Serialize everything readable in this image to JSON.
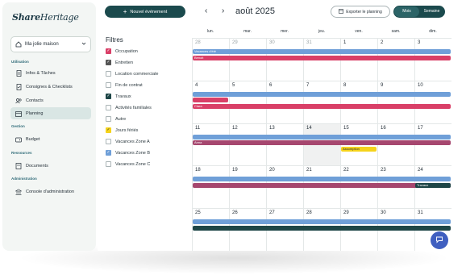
{
  "sidebar": {
    "logo_main": "Share",
    "logo_sub": "Heritage",
    "house": "Ma jolie maison",
    "sections": [
      {
        "label": "Utilisation",
        "items": [
          "Infos & Tâches",
          "Consignes & Checklists",
          "Contacts",
          "Planning"
        ]
      },
      {
        "label": "Gestion",
        "items": [
          "Budget"
        ]
      },
      {
        "label": "Ressources",
        "items": [
          "Documents"
        ]
      },
      {
        "label": "Administration",
        "items": [
          "Console d'administration"
        ]
      }
    ]
  },
  "filters": {
    "new_event": "Nouvel événement",
    "title": "Filtres",
    "items": [
      {
        "label": "Occupation",
        "checked": true,
        "color": "#d93f67"
      },
      {
        "label": "Entretien",
        "checked": true,
        "color": "#555555"
      },
      {
        "label": "Location commerciale",
        "checked": false,
        "color": ""
      },
      {
        "label": "Fin de contrat",
        "checked": false,
        "color": ""
      },
      {
        "label": "Travaux",
        "checked": true,
        "color": "#1e4647"
      },
      {
        "label": "Activités familiales",
        "checked": false,
        "color": ""
      },
      {
        "label": "Autre",
        "checked": false,
        "color": ""
      },
      {
        "label": "Jours fériés",
        "checked": true,
        "color": "#f5d31c"
      },
      {
        "label": "Vacances Zone A",
        "checked": false,
        "color": ""
      },
      {
        "label": "Vacances Zone B",
        "checked": true,
        "color": "#6f9fd8"
      },
      {
        "label": "Vacances Zone C",
        "checked": false,
        "color": ""
      }
    ]
  },
  "calendar": {
    "month": "août 2025",
    "export_label": "Exporter le planning",
    "view_month": "Mois",
    "view_week": "Semaine",
    "weekdays": [
      "lun.",
      "mar.",
      "mer.",
      "jeu.",
      "ven.",
      "sam.",
      "dim."
    ],
    "weeks": [
      [
        "28",
        "29",
        "30",
        "31",
        "1",
        "2",
        "3"
      ],
      [
        "4",
        "5",
        "6",
        "7",
        "8",
        "9",
        "10"
      ],
      [
        "11",
        "12",
        "13",
        "14",
        "15",
        "16",
        "17"
      ],
      [
        "18",
        "19",
        "20",
        "21",
        "22",
        "23",
        "24"
      ],
      [
        "25",
        "26",
        "27",
        "28",
        "29",
        "30",
        "31"
      ]
    ],
    "event_labels": {
      "vacances": "Vacances d'été",
      "benoit": "Benoit",
      "clara": "Clara",
      "anna": "Anna",
      "assomption": "Assomption",
      "travaux": "Travaux"
    }
  },
  "colors": {
    "accent": "#1b4a4d",
    "zoneB": "#6f9fd8",
    "occupation": "#d93f67",
    "holiday": "#f5d31c",
    "chat": "#3f5fc0"
  }
}
